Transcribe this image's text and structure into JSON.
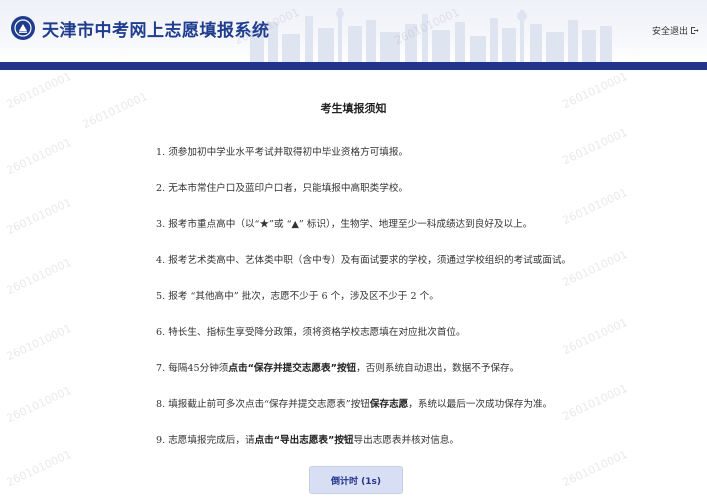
{
  "header": {
    "title": "天津市中考网上志愿填报系统",
    "logout_label": "安全退出"
  },
  "notice": {
    "title": "考生填报须知",
    "rules": [
      {
        "num": "1.",
        "pre": "须参加初中学业水平考试并取得初中毕业资格方可填报。",
        "bold": "",
        "post": ""
      },
      {
        "num": "2.",
        "pre": "无本市常住户口及蓝印户口者，只能填报中高职类学校。",
        "bold": "",
        "post": ""
      },
      {
        "num": "3.",
        "pre": "报考市重点高中（以“★”或 “▲” 标识），生物学、地理至少一科成绩达到良好及以上。",
        "bold": "",
        "post": ""
      },
      {
        "num": "4.",
        "pre": "报考艺术类高中、艺体类中职（含中专）及有面试要求的学校，须通过学校组织的考试或面试。",
        "bold": "",
        "post": ""
      },
      {
        "num": "5.",
        "pre": "报考 “其他高中” 批次，志愿不少于 6 个，涉及区不少于 2 个。",
        "bold": "",
        "post": ""
      },
      {
        "num": "6.",
        "pre": "特长生、指标生享受降分政策，须将资格学校志愿填在对应批次首位。",
        "bold": "",
        "post": ""
      },
      {
        "num": "7.",
        "pre": "每隔45分钟须",
        "bold": "点击“保存并提交志愿表”按钮",
        "post": "，否则系统自动退出，数据不予保存。"
      },
      {
        "num": "8.",
        "pre": "填报截止前可多次点击“保存并提交志愿表”按钮",
        "bold": "保存志愿",
        "post": "，系统以最后一次成功保存为准。"
      },
      {
        "num": "9.",
        "pre": "志愿填报完成后，请",
        "bold": "点击“导出志愿表”按钮",
        "post": "导出志愿表并核对信息。"
      }
    ]
  },
  "countdown": {
    "label": "倒计时 (1s)"
  },
  "watermark": {
    "text": "2601010001"
  },
  "colors": {
    "brand": "#23348c",
    "title": "#1f3d8f",
    "button_bg": "#d8def4"
  },
  "icons": {
    "logo": "emblem-logo-icon",
    "logout": "exit-icon"
  }
}
